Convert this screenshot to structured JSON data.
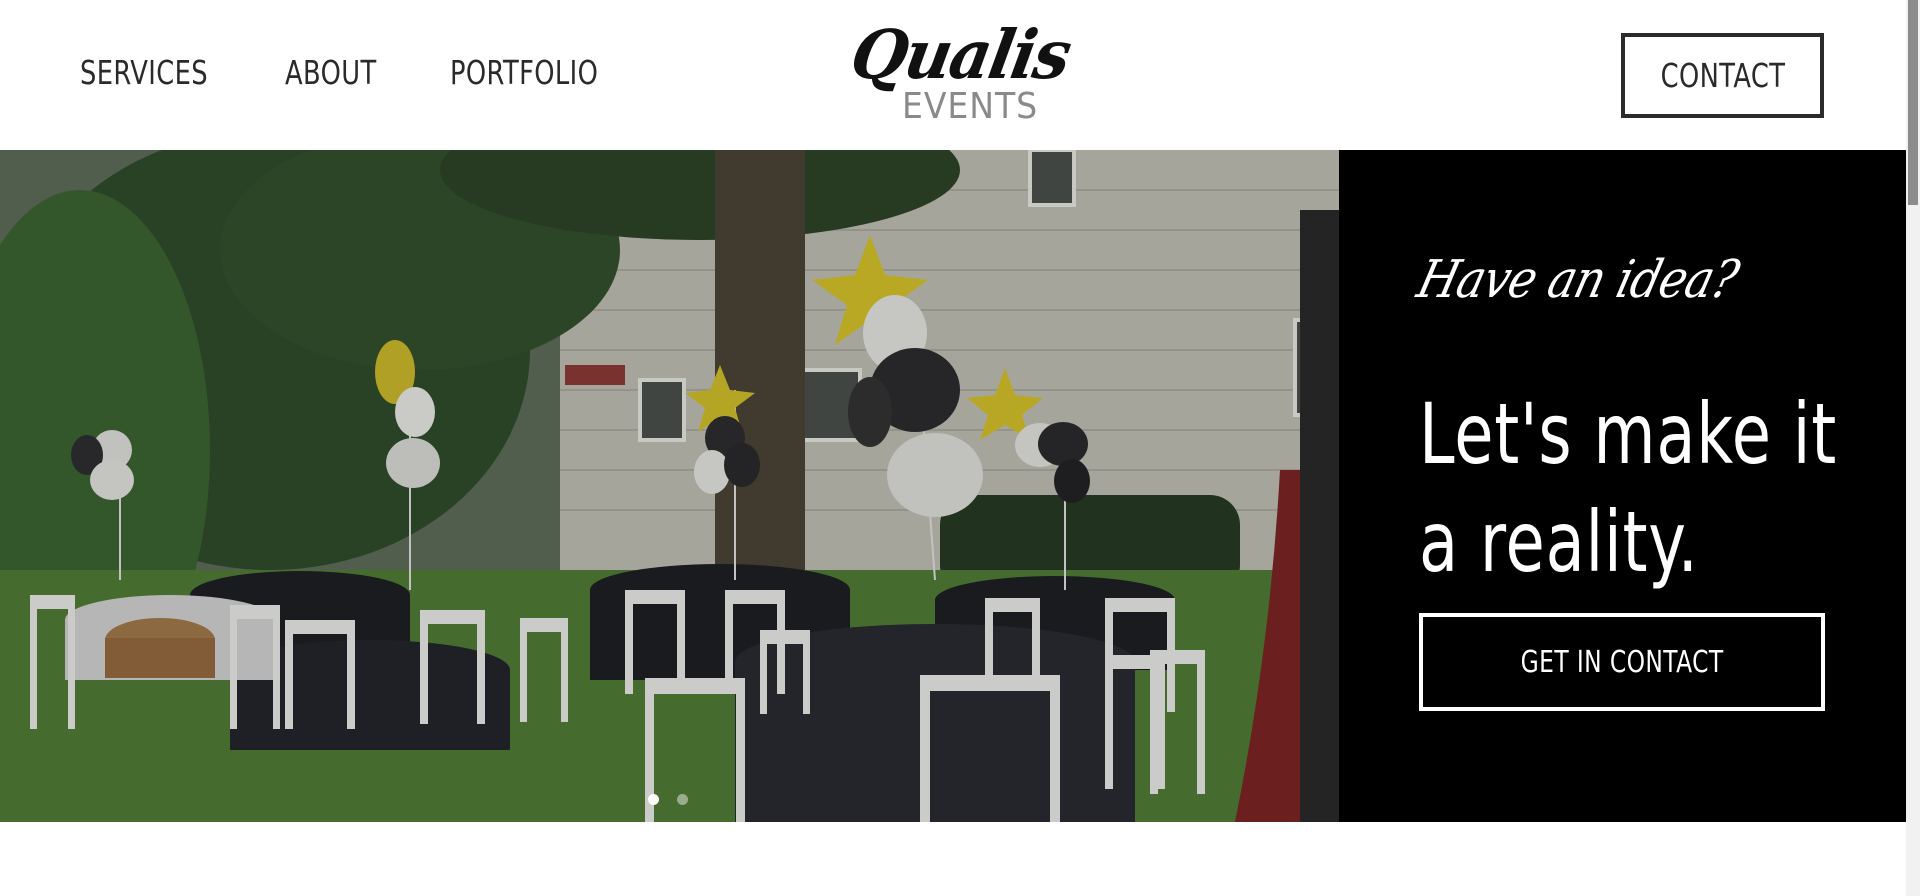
{
  "nav": {
    "links": [
      "SERVICES",
      "ABOUT",
      "PORTFOLIO"
    ]
  },
  "logo": {
    "script": "Qualis",
    "sub": "EVENTS"
  },
  "header": {
    "contact_label": "CONTACT"
  },
  "hero": {
    "tagline": "Have an idea?",
    "headline": "Let's make it a reality.",
    "cta_label": "GET IN CONTACT",
    "slide_count": 2,
    "active_slide": 1
  },
  "colors": {
    "panel": "#000000",
    "text_dark": "#2a2a2a",
    "logo_grey": "#8a8a8a"
  }
}
